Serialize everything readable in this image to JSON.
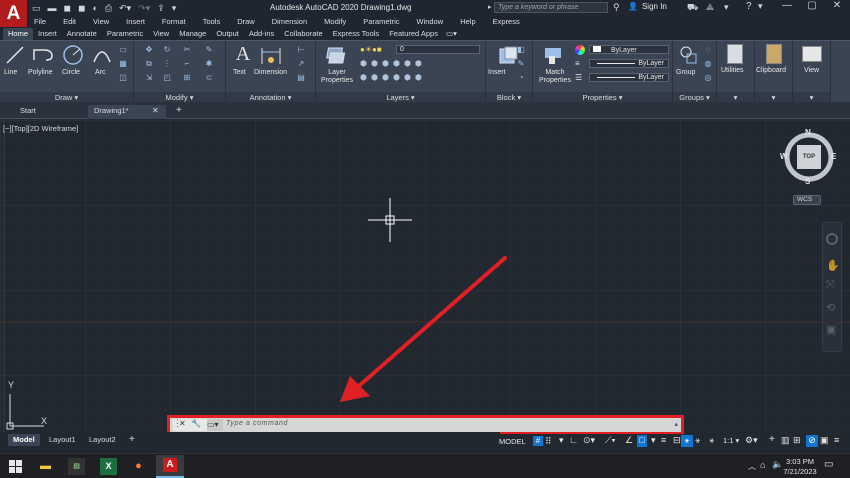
{
  "app": {
    "logo": "A",
    "title": "Autodesk AutoCAD 2020   Drawing1.dwg",
    "search_placeholder": "Type a keyword or phrase",
    "sign_in": "Sign In"
  },
  "menubar": [
    "File",
    "Edit",
    "View",
    "Insert",
    "Format",
    "Tools",
    "Draw",
    "Dimension",
    "Modify",
    "Parametric",
    "Window",
    "Help",
    "Express"
  ],
  "ribbon_tabs": [
    {
      "label": "Home",
      "active": true
    },
    {
      "label": "Insert"
    },
    {
      "label": "Annotate"
    },
    {
      "label": "Parametric"
    },
    {
      "label": "View"
    },
    {
      "label": "Manage"
    },
    {
      "label": "Output"
    },
    {
      "label": "Add-ins"
    },
    {
      "label": "Collaborate"
    },
    {
      "label": "Express Tools"
    },
    {
      "label": "Featured Apps"
    }
  ],
  "ribbon": {
    "draw": {
      "title": "Draw",
      "line": "Line",
      "polyline": "Polyline",
      "circle": "Circle",
      "arc": "Arc"
    },
    "modify": {
      "title": "Modify"
    },
    "annotation": {
      "title": "Annotation",
      "text": "Text",
      "dimension": "Dimension"
    },
    "layers": {
      "title": "Layers",
      "layer_properties": "Layer Properties",
      "current_layer": "0"
    },
    "block": {
      "title": "Block",
      "insert": "Insert"
    },
    "properties": {
      "title": "Properties",
      "match_properties": "Match Properties",
      "color": "ByLayer",
      "linetype": "ByLayer",
      "lineweight": "ByLayer"
    },
    "groups": {
      "title": "Groups",
      "group": "Group"
    },
    "utilities": {
      "label": "Utilities"
    },
    "clipboard": {
      "label": "Clipboard"
    },
    "view": {
      "label": "View"
    }
  },
  "doc_tabs": [
    {
      "label": "Start"
    },
    {
      "label": "Drawing1*",
      "active": true
    }
  ],
  "viewport": {
    "label": "[−][Top][2D Wireframe]",
    "viewcube": {
      "top": "TOP",
      "n": "N",
      "s": "S",
      "e": "E",
      "w": "W",
      "wcs": "WCS"
    },
    "ucs_x": "X",
    "ucs_y": "Y"
  },
  "layout_tabs": [
    {
      "label": "Model",
      "active": true
    },
    {
      "label": "Layout1"
    },
    {
      "label": "Layout2"
    }
  ],
  "command": {
    "placeholder": "Type a command"
  },
  "status": {
    "model": "MODEL",
    "scale": "1:1"
  },
  "clock": {
    "time": "3:03 PM",
    "date": "7/21/2023"
  },
  "colors": {
    "highlight": "#e02024",
    "accent": "#0f75d0",
    "background": "#212830",
    "ribbon": "#3b4453"
  }
}
